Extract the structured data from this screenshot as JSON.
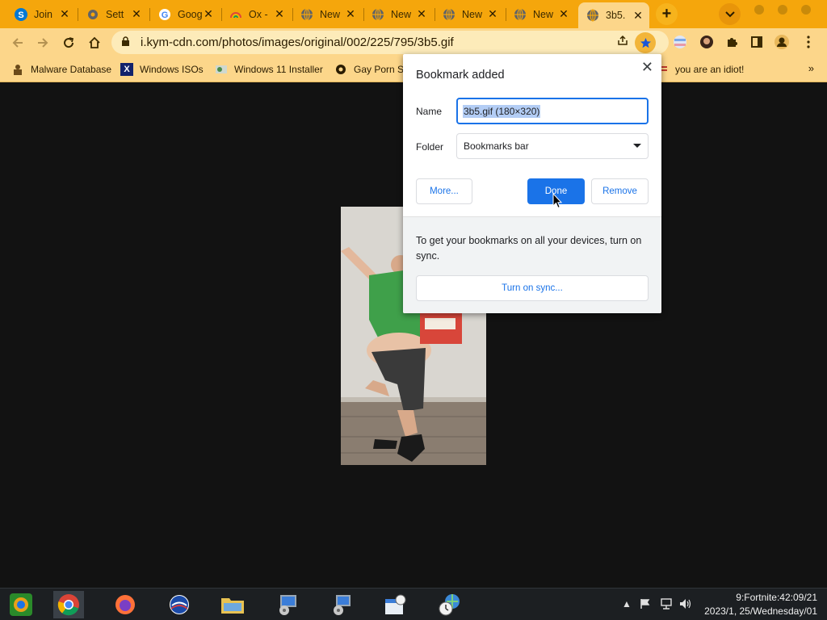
{
  "tabs": [
    {
      "title": "Join",
      "icon": "skype-icon",
      "color": "#0078d4"
    },
    {
      "title": "Sett",
      "icon": "gear-icon",
      "color": "#5f6368"
    },
    {
      "title": "Goog",
      "icon": "google-icon",
      "color": "#4285f4"
    },
    {
      "title": "Ox -",
      "icon": "rainbow-icon",
      "color": "#e0443a"
    },
    {
      "title": "New",
      "icon": "globe-icon",
      "color": "#5f6368"
    },
    {
      "title": "New",
      "icon": "globe-icon",
      "color": "#5f6368"
    },
    {
      "title": "New",
      "icon": "globe-icon",
      "color": "#5f6368"
    },
    {
      "title": "New",
      "icon": "globe-icon",
      "color": "#5f6368"
    },
    {
      "title": "3b5.",
      "icon": "globe-icon",
      "color": "#5f6368",
      "active": true
    }
  ],
  "address": {
    "url": "i.kym-cdn.com/photos/images/original/002/225/795/3b5.gif"
  },
  "bookmarks_bar": {
    "items": [
      {
        "label": "Malware Database",
        "icon": "malware-icon"
      },
      {
        "label": "Windows ISOs",
        "icon": "x-icon"
      },
      {
        "label": "Windows 11 Installer",
        "icon": "installer-icon"
      },
      {
        "label": "Gay Porn Se",
        "icon": "gear-icon"
      },
      {
        "label": "you are an idiot!",
        "icon": "flag-icon"
      }
    ],
    "overflow": "»"
  },
  "bubble": {
    "title": "Bookmark added",
    "name_label": "Name",
    "name_value": "3b5.gif (180×320)",
    "folder_label": "Folder",
    "folder_value": "Bookmarks bar",
    "more_label": "More...",
    "done_label": "Done",
    "remove_label": "Remove",
    "sync_message": "To get your bookmarks on all your devices, turn on sync.",
    "sync_button": "Turn on sync..."
  },
  "taskbar": {
    "apps": [
      {
        "name": "start-button"
      },
      {
        "name": "chrome-app",
        "active": true
      },
      {
        "name": "firefox-app"
      },
      {
        "name": "obama-app"
      },
      {
        "name": "file-explorer-app"
      },
      {
        "name": "installer-app"
      },
      {
        "name": "network-setup-app"
      },
      {
        "name": "calendar-app"
      },
      {
        "name": "globe-clock-app"
      }
    ],
    "clock_line1": "9:Fortnite:42:09/21",
    "clock_line2": "2023/1, 25/Wednesday/01"
  },
  "colors": {
    "tabstrip": "#f5a60c",
    "toolbar": "#fcd68a",
    "accent_blue": "#1a73e8",
    "page_bg": "#121212"
  }
}
